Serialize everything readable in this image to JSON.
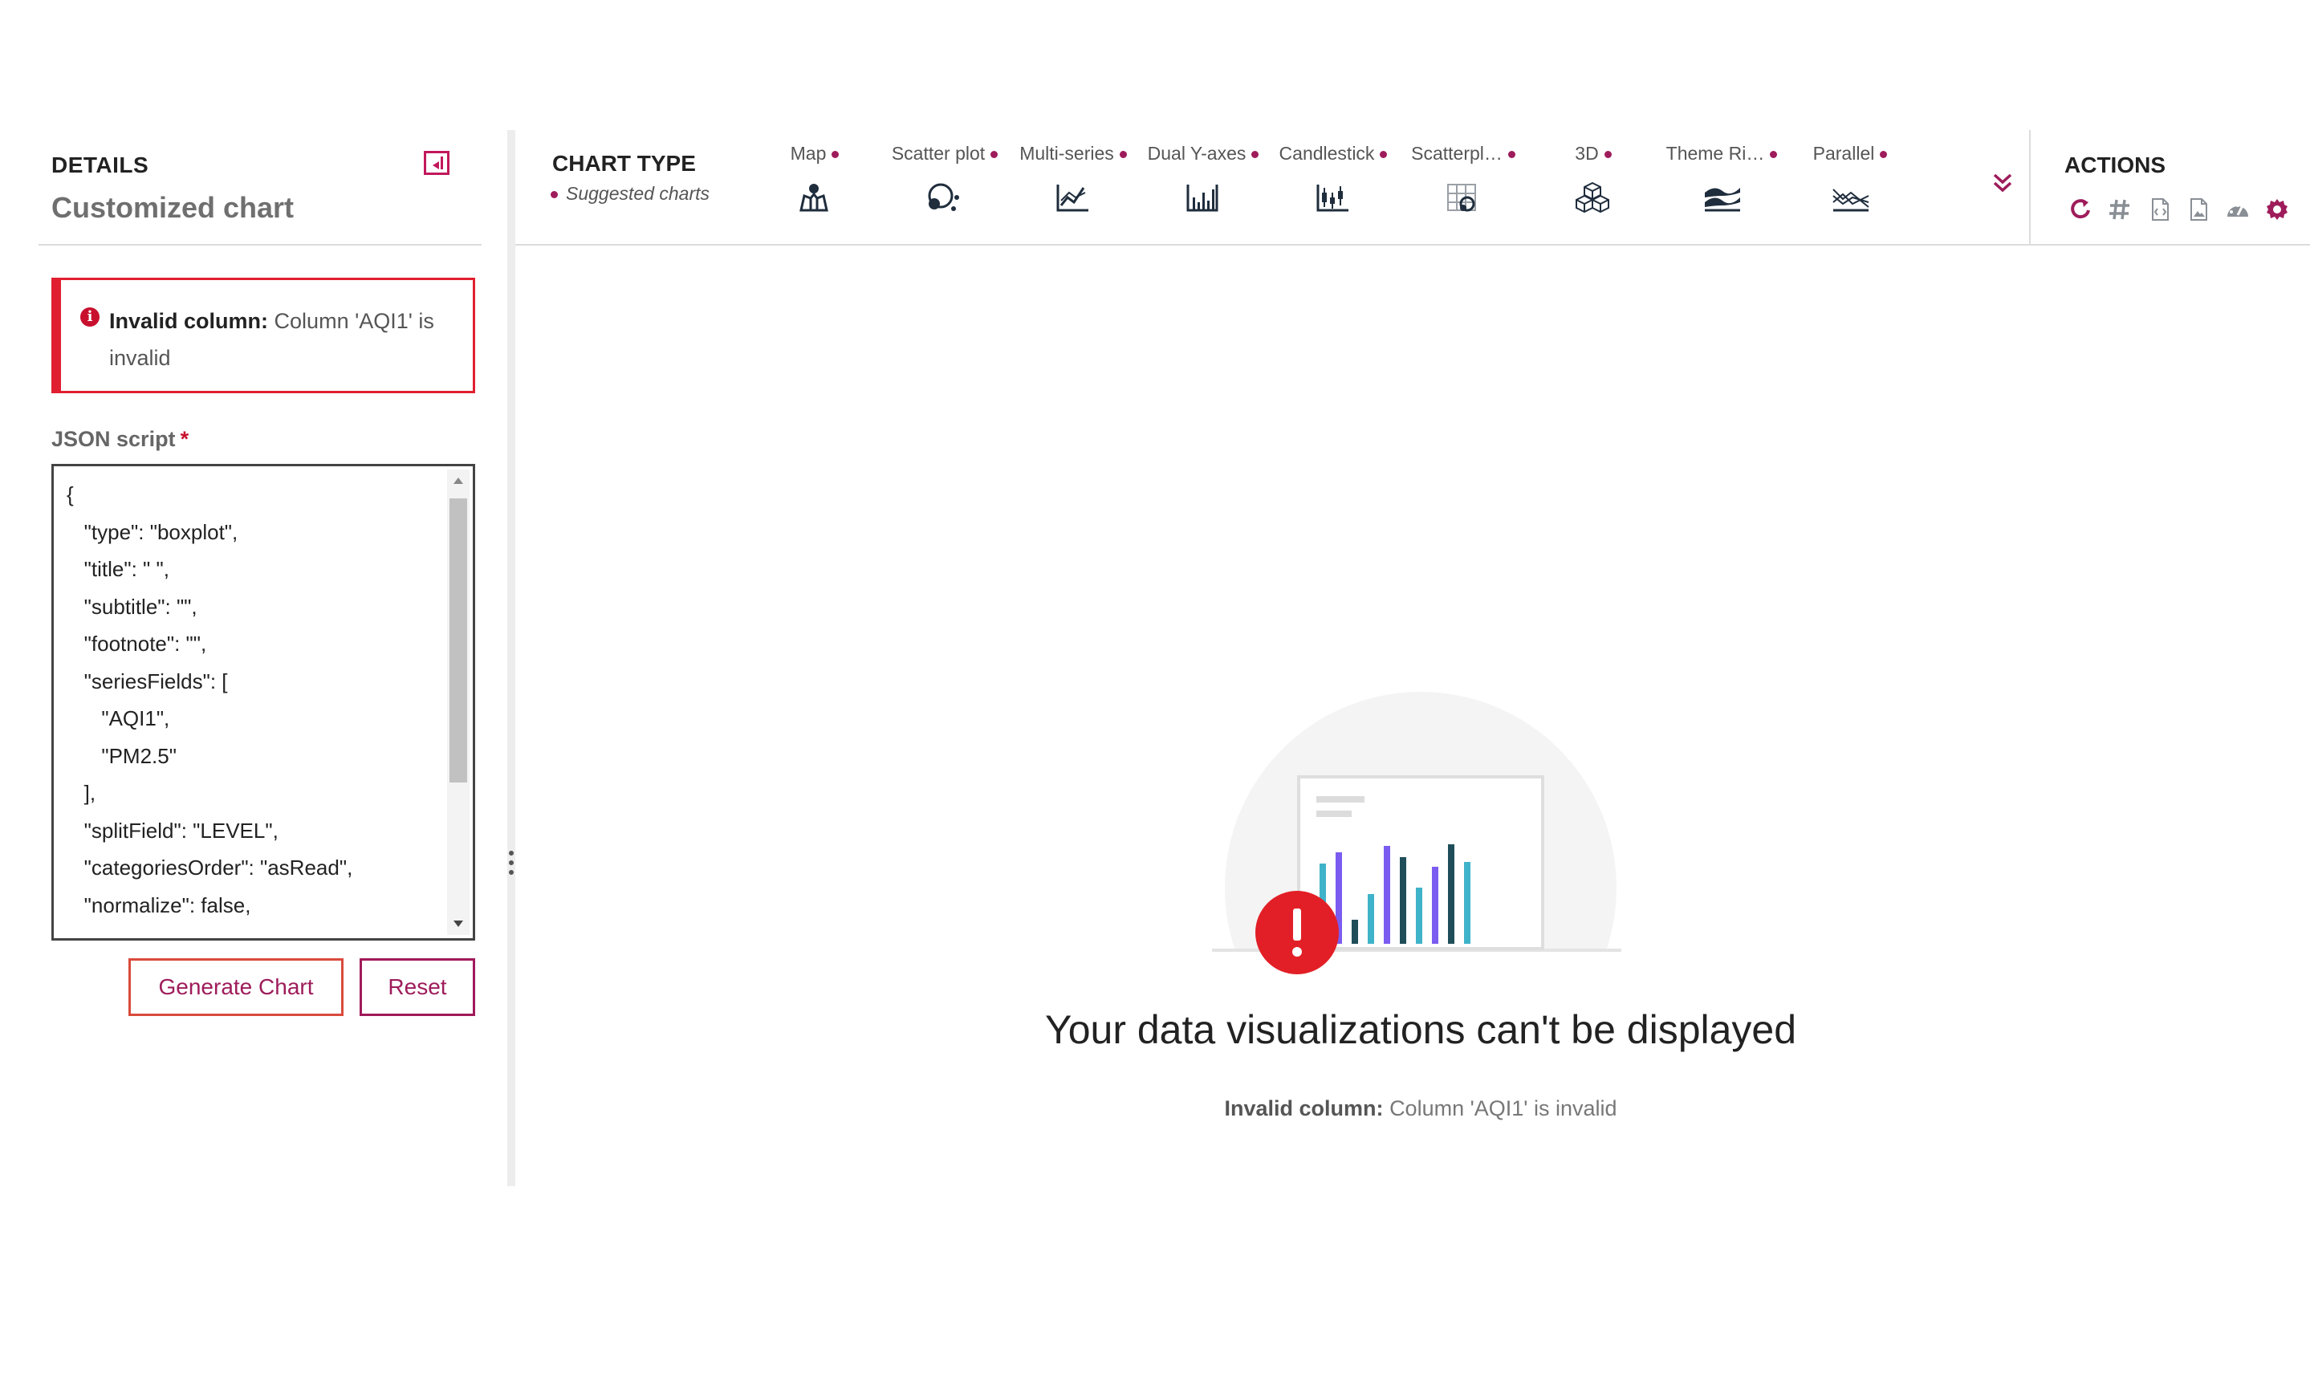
{
  "details": {
    "title": "DETAILS",
    "subtitle": "Customized chart"
  },
  "error": {
    "prefix": "Invalid column:",
    "message": "Column 'AQI1' is invalid"
  },
  "json_script": {
    "label": "JSON script",
    "required_mark": "*",
    "code": "{\n   \"type\": \"boxplot\",\n   \"title\": \" \",\n   \"subtitle\": \"\",\n   \"footnote\": \"\",\n   \"seriesFields\": [\n      \"AQI1\",\n      \"PM2.5\"\n   ],\n   \"splitField\": \"LEVEL\",\n   \"categoriesOrder\": \"asRead\",\n   \"normalize\": false,"
  },
  "buttons": {
    "generate": "Generate Chart",
    "reset": "Reset"
  },
  "chart_type": {
    "title": "CHART TYPE",
    "suggested_label": "Suggested charts",
    "items": [
      {
        "label": "Map",
        "icon": "map-icon"
      },
      {
        "label": "Scatter plot",
        "icon": "scatter-plot-icon"
      },
      {
        "label": "Multi-series",
        "icon": "multi-series-icon"
      },
      {
        "label": "Dual Y-axes",
        "icon": "dual-y-axes-icon"
      },
      {
        "label": "Candlestick",
        "icon": "candlestick-icon"
      },
      {
        "label": "Scatterpl…",
        "icon": "scatterplot-matrix-icon"
      },
      {
        "label": "3D",
        "icon": "3d-icon"
      },
      {
        "label": "Theme Ri…",
        "icon": "theme-river-icon"
      },
      {
        "label": "Parallel",
        "icon": "parallel-icon"
      }
    ]
  },
  "actions": {
    "title": "ACTIONS",
    "icons": [
      "refresh-icon",
      "hash-icon",
      "code-file-icon",
      "image-file-icon",
      "dashboard-icon",
      "settings-gear-icon"
    ]
  },
  "empty_state": {
    "title": "Your data visualizations can't be displayed",
    "detail_prefix": "Invalid column:",
    "detail_message": "Column 'AQI1' is invalid"
  },
  "colors": {
    "accent": "#9e1c5b",
    "error": "#e02030",
    "teal": "#3fb3c9",
    "purple": "#7b5cf0",
    "dark_teal": "#1f4e5a"
  }
}
